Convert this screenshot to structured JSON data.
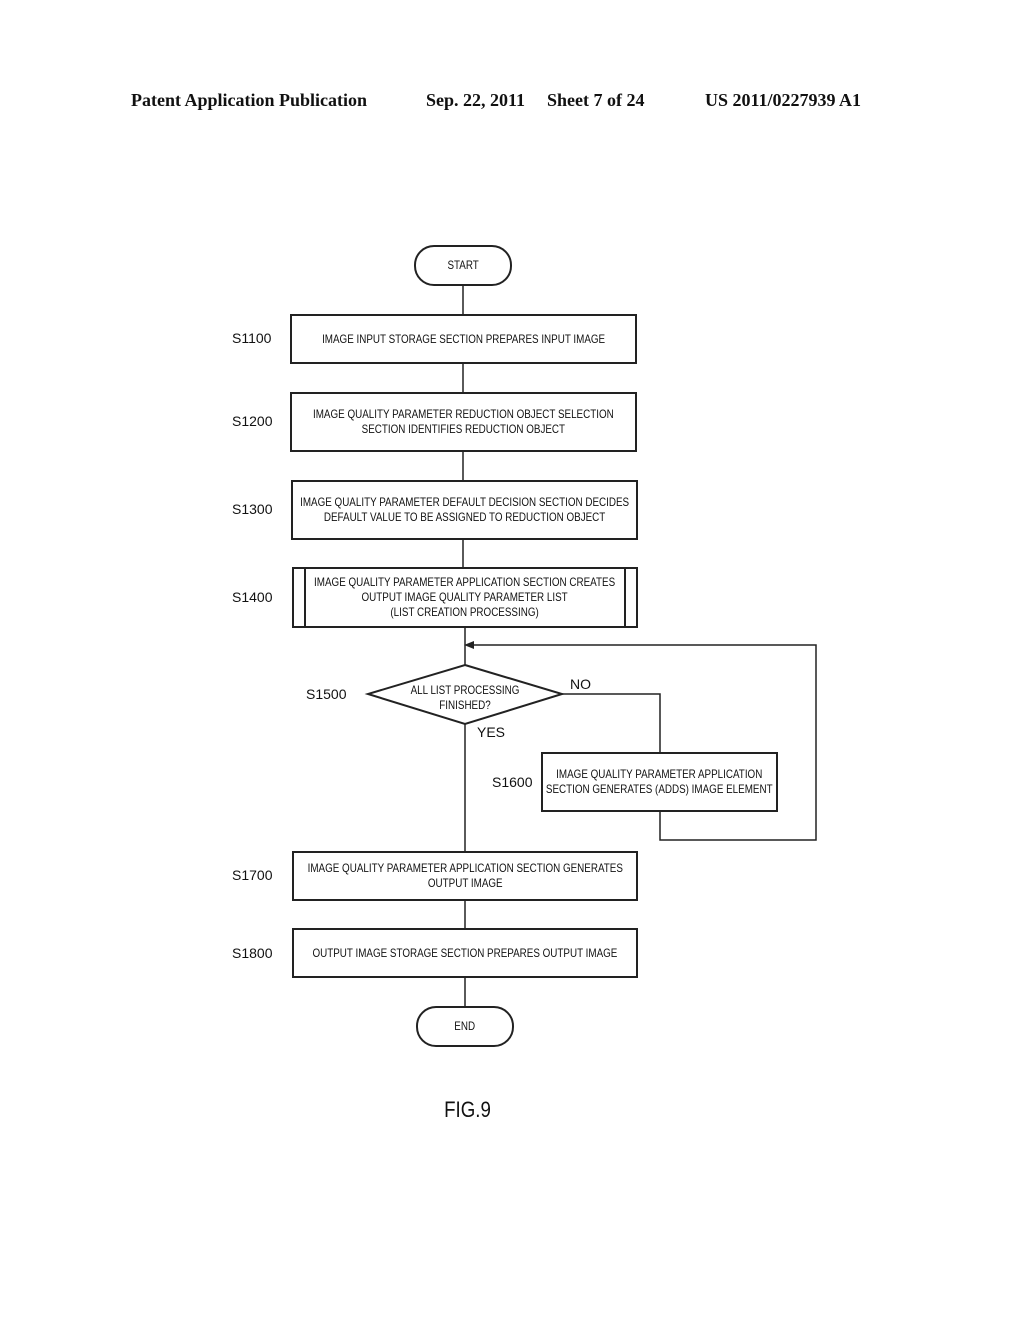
{
  "header": {
    "publication": "Patent Application Publication",
    "date": "Sep. 22, 2011",
    "sheet": "Sheet 7 of 24",
    "number": "US 2011/0227939 A1"
  },
  "flowchart": {
    "start": "START",
    "end": "END",
    "steps": [
      {
        "id": "S1100",
        "lines": [
          "IMAGE INPUT STORAGE SECTION PREPARES INPUT IMAGE"
        ]
      },
      {
        "id": "S1200",
        "lines": [
          "IMAGE QUALITY PARAMETER REDUCTION OBJECT SELECTION",
          "SECTION IDENTIFIES REDUCTION OBJECT"
        ]
      },
      {
        "id": "S1300",
        "lines": [
          "IMAGE QUALITY PARAMETER DEFAULT DECISION SECTION DECIDES",
          "DEFAULT VALUE TO BE ASSIGNED TO REDUCTION OBJECT"
        ]
      },
      {
        "id": "S1400",
        "lines": [
          "IMAGE QUALITY PARAMETER APPLICATION SECTION CREATES",
          "OUTPUT IMAGE QUALITY PARAMETER LIST",
          "(LIST CREATION PROCESSING)"
        ]
      },
      {
        "id": "S1500",
        "lines": [
          "ALL LIST PROCESSING",
          "FINISHED?"
        ],
        "yes": "YES",
        "no": "NO"
      },
      {
        "id": "S1600",
        "lines": [
          "IMAGE QUALITY PARAMETER APPLICATION",
          "SECTION GENERATES (ADDS) IMAGE ELEMENT"
        ]
      },
      {
        "id": "S1700",
        "lines": [
          "IMAGE QUALITY PARAMETER APPLICATION SECTION GENERATES",
          "OUTPUT IMAGE"
        ]
      },
      {
        "id": "S1800",
        "lines": [
          "OUTPUT IMAGE STORAGE SECTION PREPARES OUTPUT IMAGE"
        ]
      }
    ]
  },
  "figure_label": "FIG.9"
}
